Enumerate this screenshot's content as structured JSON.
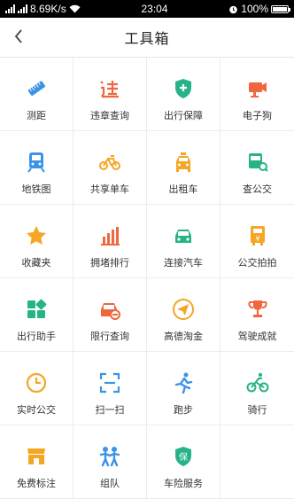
{
  "status": {
    "speed": "8.69K/s",
    "time": "23:04",
    "battery": "100%"
  },
  "header": {
    "title": "工具箱"
  },
  "tools": [
    {
      "label": "测距",
      "icon": "ruler-icon",
      "color": "#3a93e6"
    },
    {
      "label": "违章查询",
      "icon": "violation-icon",
      "color": "#f0663f"
    },
    {
      "label": "出行保障",
      "icon": "shield-plus-icon",
      "color": "#26b386"
    },
    {
      "label": "电子狗",
      "icon": "camera-icon",
      "color": "#f0663f"
    },
    {
      "label": "地铁图",
      "icon": "subway-icon",
      "color": "#3a93e6"
    },
    {
      "label": "共享单车",
      "icon": "bike-icon",
      "color": "#f5a623"
    },
    {
      "label": "出租车",
      "icon": "taxi-icon",
      "color": "#f5a623"
    },
    {
      "label": "查公交",
      "icon": "bus-search-icon",
      "color": "#26b386"
    },
    {
      "label": "收藏夹",
      "icon": "star-icon",
      "color": "#f5a623"
    },
    {
      "label": "拥堵排行",
      "icon": "bar-chart-icon",
      "color": "#f0663f"
    },
    {
      "label": "连接汽车",
      "icon": "car-connect-icon",
      "color": "#26b386"
    },
    {
      "label": "公交拍拍",
      "icon": "bus-photo-icon",
      "color": "#f5a623"
    },
    {
      "label": "出行助手",
      "icon": "assistant-grid-icon",
      "color": "#26b386"
    },
    {
      "label": "限行查询",
      "icon": "car-limit-icon",
      "color": "#f0663f"
    },
    {
      "label": "高德淘金",
      "icon": "paper-plane-icon",
      "color": "#f5a623"
    },
    {
      "label": "驾驶成就",
      "icon": "trophy-icon",
      "color": "#f0663f"
    },
    {
      "label": "实时公交",
      "icon": "clock-icon",
      "color": "#f5a623"
    },
    {
      "label": "扫一扫",
      "icon": "scan-icon",
      "color": "#3a93e6"
    },
    {
      "label": "跑步",
      "icon": "running-icon",
      "color": "#3a93e6"
    },
    {
      "label": "骑行",
      "icon": "cycling-icon",
      "color": "#26b386"
    },
    {
      "label": "免费标注",
      "icon": "shop-icon",
      "color": "#f5a623"
    },
    {
      "label": "组队",
      "icon": "team-icon",
      "color": "#3a93e6"
    },
    {
      "label": "车险服务",
      "icon": "insurance-shield-icon",
      "color": "#26b386"
    }
  ]
}
